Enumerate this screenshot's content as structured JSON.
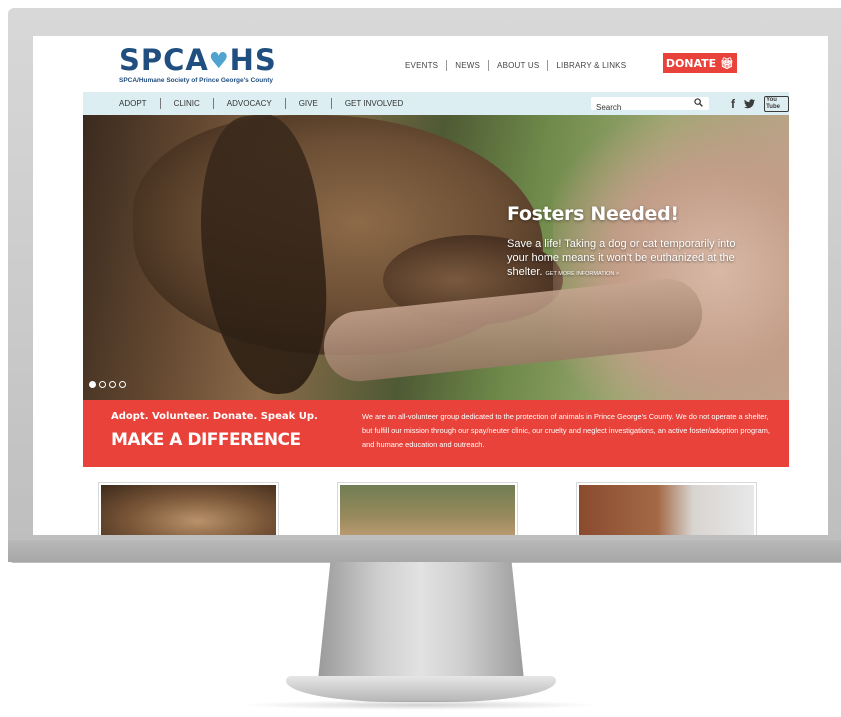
{
  "site": {
    "logo_text": "SPCA",
    "logo_text_end": "HS",
    "logo_subtitle": "SPCA/Humane Society of Prince George's County"
  },
  "top_nav": {
    "items": [
      "EVENTS",
      "NEWS",
      "ABOUT US",
      "LIBRARY & LINKS"
    ],
    "donate_label": "DONATE"
  },
  "main_nav": {
    "items": [
      "ADOPT",
      "CLINIC",
      "ADVOCACY",
      "GIVE",
      "GET INVOLVED"
    ]
  },
  "search": {
    "placeholder": "Search"
  },
  "social": {
    "facebook": "f",
    "twitter": "t",
    "youtube": "You Tube"
  },
  "hero": {
    "title": "Fosters Needed!",
    "body": "Save a life! Taking a dog or cat temporarily into your home means it won't be euthanized at the shelter.",
    "link": "GET MORE INFORMATION >",
    "slide_count": 4,
    "active_slide": 0
  },
  "band": {
    "tagline": "Adopt. Volunteer. Donate. Speak Up.",
    "headline": "MAKE A DIFFERENCE",
    "text": "We are an all-volunteer group dedicated to the protection of animals in Prince George's County. We do not operate a shelter, but fulfill our mission through our spay/neuter clinic, our cruelty and neglect investigations, an active foster/adoption program, and humane education and outreach."
  },
  "colors": {
    "brand_blue": "#1f4e7f",
    "accent_red": "#e8423a",
    "nav_bg": "#ddeef2"
  }
}
